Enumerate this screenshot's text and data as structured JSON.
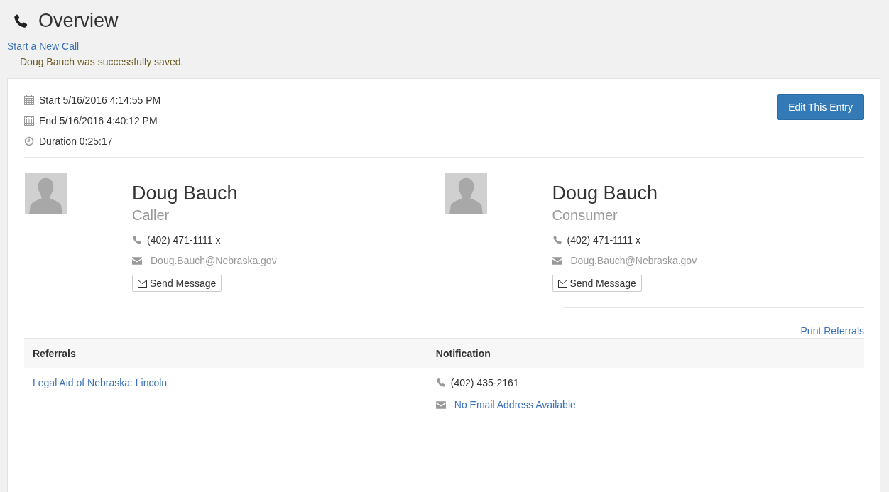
{
  "header": {
    "title": "Overview",
    "new_call_link": "Start a New Call",
    "message": "Doug Bauch was successfully saved."
  },
  "call": {
    "times": [
      {
        "kind": "start",
        "text": "Start 5/16/2016 4:14:55 PM"
      },
      {
        "kind": "end",
        "text": "End 5/16/2016 4:40:12 PM"
      },
      {
        "kind": "duration",
        "text": "Duration 0:25:17"
      }
    ],
    "edit_button": "Edit This Entry"
  },
  "people": [
    {
      "name": "Doug Bauch",
      "role": "Caller",
      "phone": "(402) 471-1111 x",
      "email": "Doug.Bauch@Nebraska.gov",
      "send_button": "Send Message"
    },
    {
      "name": "Doug Bauch",
      "role": "Consumer",
      "phone": "(402) 471-1111 x",
      "email": "Doug.Bauch@Nebraska.gov",
      "send_button": "Send Message"
    }
  ],
  "referrals": {
    "print_link": "Print Referrals",
    "columns": [
      "Referrals",
      "Notification"
    ],
    "rows": [
      {
        "name": "Legal Aid of Nebraska: Lincoln",
        "phone": "(402) 435-2161",
        "email": "No Email Address Available"
      }
    ]
  }
}
